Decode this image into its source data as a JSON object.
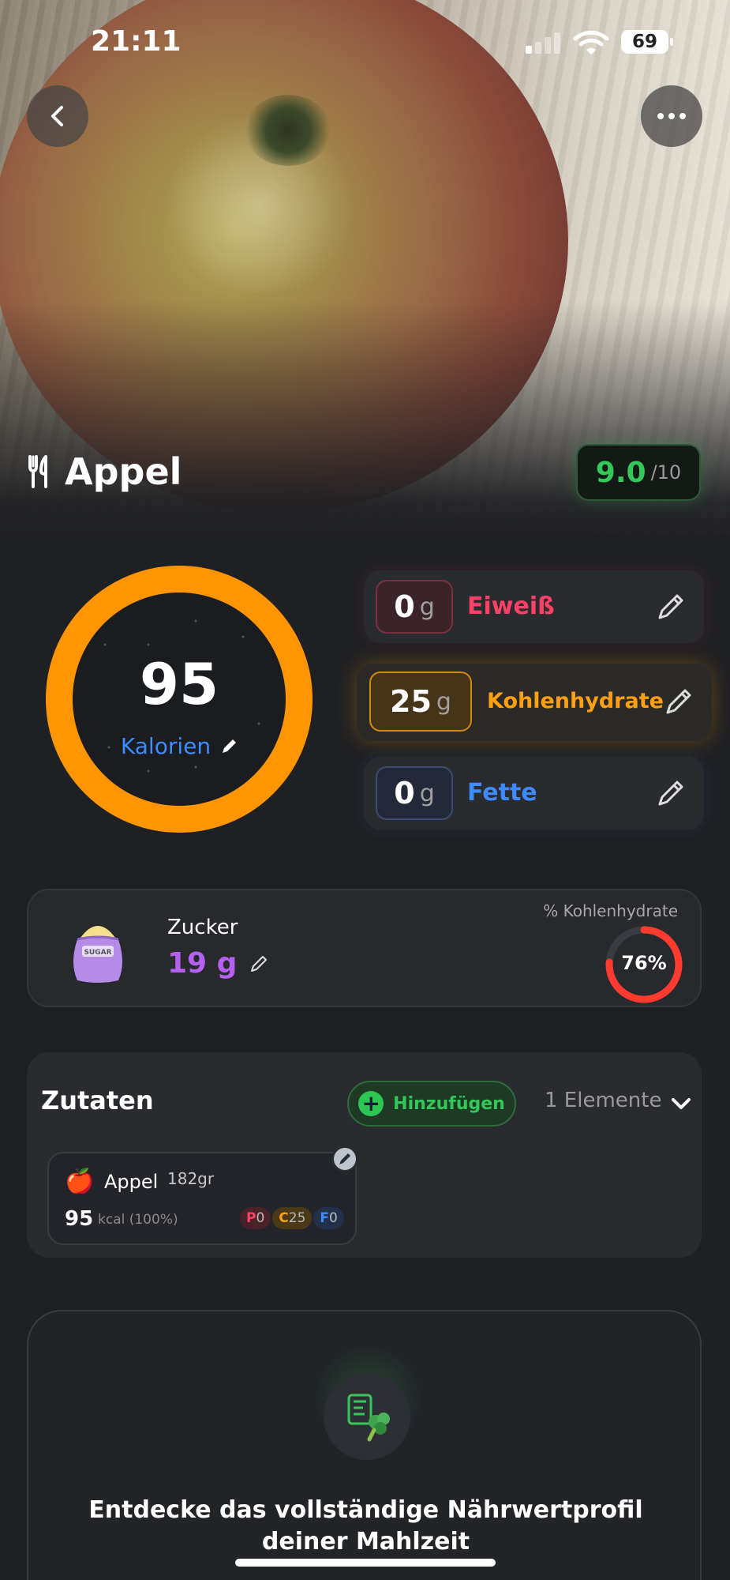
{
  "status_bar": {
    "time": "21:11",
    "battery": "69"
  },
  "food": {
    "title": "Appel",
    "score": "9.0",
    "score_max": "/10"
  },
  "calories": {
    "value": "95",
    "label": "Kalorien",
    "ring_color": "#ff9500",
    "fill_fraction": 1.0
  },
  "macros": {
    "protein": {
      "value": "0",
      "unit": "g",
      "label": "Eiweiß",
      "color": "#ff4067"
    },
    "carbs": {
      "value": "25",
      "unit": "g",
      "label": "Kohlenhydrate",
      "color": "#ffa010"
    },
    "fat": {
      "value": "0",
      "unit": "g",
      "label": "Fette",
      "color": "#3d8bff"
    }
  },
  "sugar": {
    "title": "Zucker",
    "value": "19 g",
    "pct_label": "% Kohlenhydrate",
    "pct_text": "76%",
    "pct_fraction": 0.76,
    "bag_label": "SUGAR"
  },
  "ingredients": {
    "title": "Zutaten",
    "add_label": "Hinzufügen",
    "count_label": "1 Elemente",
    "items": [
      {
        "emoji": "🍎",
        "name": "Appel",
        "weight": "182gr",
        "kcal": "95",
        "kcal_unit": "kcal (100%)",
        "p_key": "P",
        "p_val": "0",
        "c_key": "C",
        "c_val": "25",
        "f_key": "F",
        "f_val": "0"
      }
    ]
  },
  "promo": {
    "text": "Entdecke das vollständige Nährwertprofil deiner Mahlzeit"
  },
  "icons": {
    "back": "chevron-left-icon",
    "more": "more-horizontal-icon",
    "fork_knife": "fork-knife-icon",
    "edit": "pencil-icon",
    "chevron": "chevron-down-icon"
  }
}
